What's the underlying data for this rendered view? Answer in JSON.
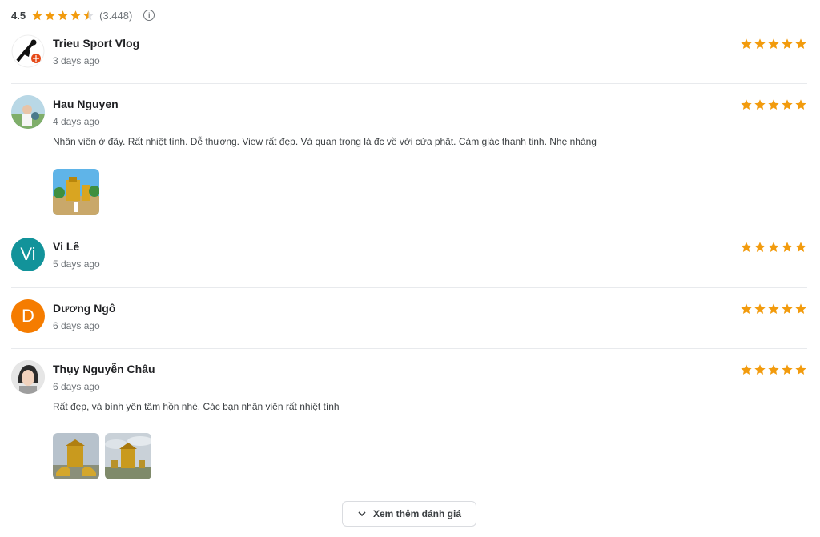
{
  "summary": {
    "rating": "4.5",
    "count": "(3.448)",
    "info_icon": "i",
    "stars_filled": 4.5
  },
  "reviews": [
    {
      "name": "Trieu Sport Vlog",
      "time": "3 days ago",
      "stars": 5,
      "text": ""
    },
    {
      "name": "Hau Nguyen",
      "time": "4 days ago",
      "stars": 5,
      "text": "Nhân viên ở đây. Rất nhiệt tình. Dễ thương. View rất đẹp. Và quan trọng là đc về với cửa phật. Cảm giác thanh tịnh. Nhẹ nhàng"
    },
    {
      "name": "Vi Lê",
      "time": "5 days ago",
      "stars": 5,
      "text": "",
      "initial": "Vi",
      "avatar_color": "#12939a"
    },
    {
      "name": "Dương Ngô",
      "time": "6 days ago",
      "stars": 5,
      "text": "",
      "initial": "D",
      "avatar_color": "#f57c00"
    },
    {
      "name": "Thụy Nguyễn Châu",
      "time": "6 days ago",
      "stars": 5,
      "text": "Rất đẹp, và bình yên tâm hồn nhé. Các bạn nhân viên rất nhiệt tình"
    }
  ],
  "more_button": {
    "label": "Xem thêm đánh giá"
  },
  "colors": {
    "star": "#f29b0d",
    "star_empty": "#dadce0"
  }
}
